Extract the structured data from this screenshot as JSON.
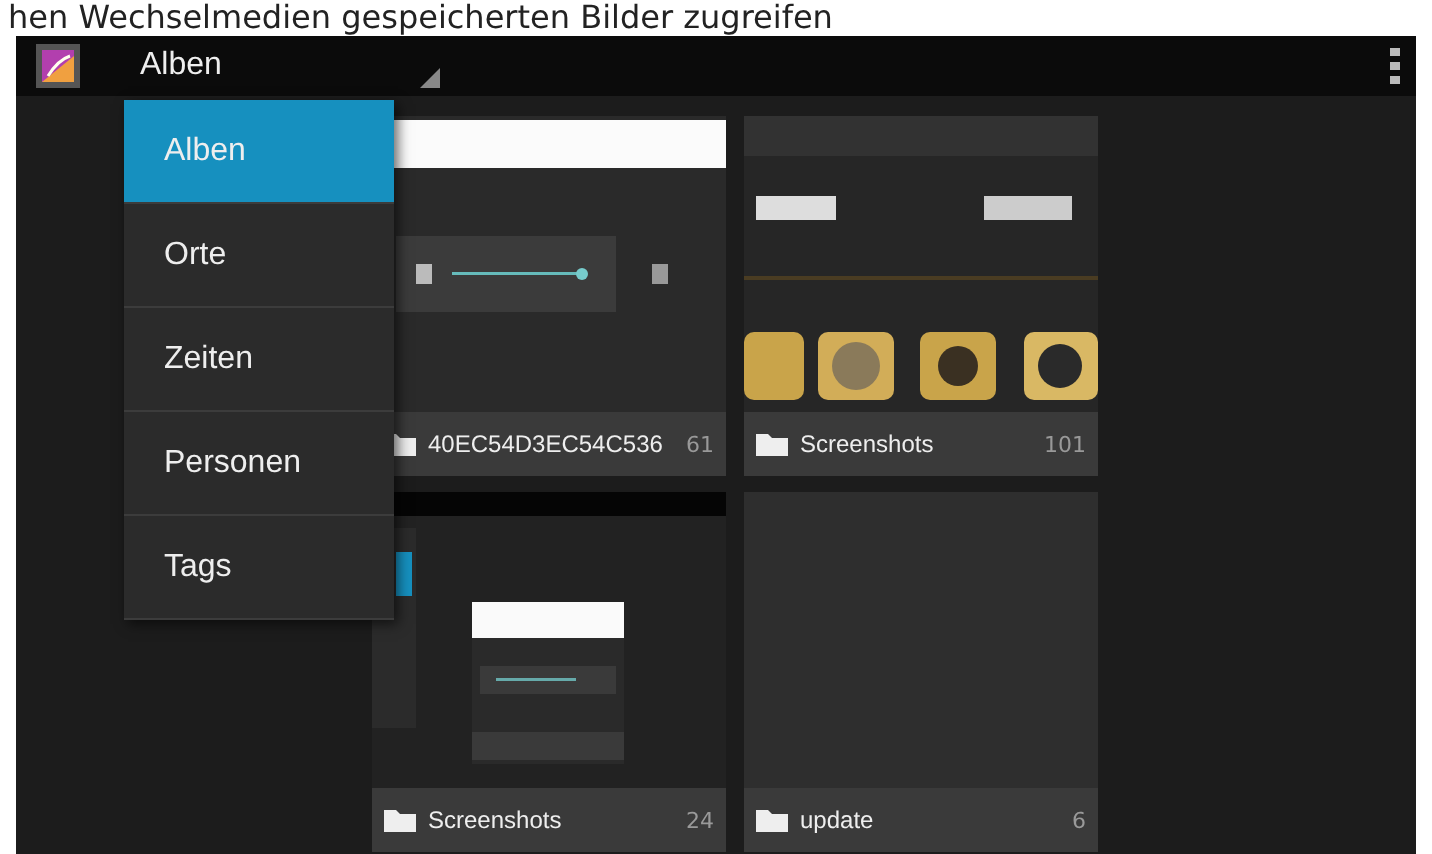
{
  "caption": "hen Wechselmedien gespeicherten Bilder zugreifen",
  "action_bar": {
    "title": "Alben"
  },
  "menu": [
    {
      "label": "Alben",
      "selected": true
    },
    {
      "label": "Orte",
      "selected": false
    },
    {
      "label": "Zeiten",
      "selected": false
    },
    {
      "label": "Personen",
      "selected": false
    },
    {
      "label": "Tags",
      "selected": false
    }
  ],
  "albums": [
    {
      "name": "40EC54D3EC54C536",
      "count": "61",
      "kind": "picture"
    },
    {
      "name": "Screenshots",
      "count": "101",
      "kind": "picture"
    },
    {
      "name": "Screenshots",
      "count": "24",
      "kind": "picture"
    },
    {
      "name": "update",
      "count": "6",
      "kind": "empty"
    }
  ]
}
